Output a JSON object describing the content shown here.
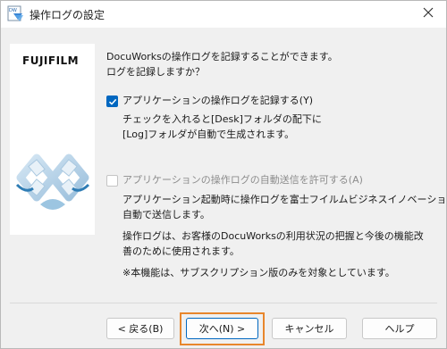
{
  "window": {
    "title": "操作ログの設定",
    "app_icon": "docuworks-app-icon",
    "close_icon": "close-icon"
  },
  "sidebar": {
    "logo_text": "FUJIFILM",
    "artwork_icon": "docuworks-infinity-artwork"
  },
  "intro": {
    "line1": "DocuWorksの操作ログを記録することができます。",
    "line2": "ログを記録しますか？"
  },
  "record_option": {
    "label": "アプリケーションの操作ログを記録する(Y)",
    "checked": true,
    "enabled": true,
    "desc_line1": "チェックを入れると[Desk]フォルダの配下に",
    "desc_line2": "[Log]フォルダが自動で生成されます。"
  },
  "send_option": {
    "label": "アプリケーションの操作ログの自動送信を許可する(A)",
    "checked": false,
    "enabled": false,
    "desc_line1": "アプリケーション起動時に操作ログを富士フイルムビジネスイノベーションへ",
    "desc_line2": "自動で送信します。",
    "usage_line1": "操作ログは、お客様のDocuWorksの利用状況の把握と今後の機能改",
    "usage_line2": "善のために使用されます。",
    "note": "※本機能は、サブスクリプション版のみを対象としています。"
  },
  "buttons": {
    "back": "< 戻る(B)",
    "next": "次へ(N) >",
    "cancel": "キャンセル",
    "help": "ヘルプ"
  },
  "colors": {
    "accent": "#0067c0",
    "highlight": "#e8862c"
  }
}
